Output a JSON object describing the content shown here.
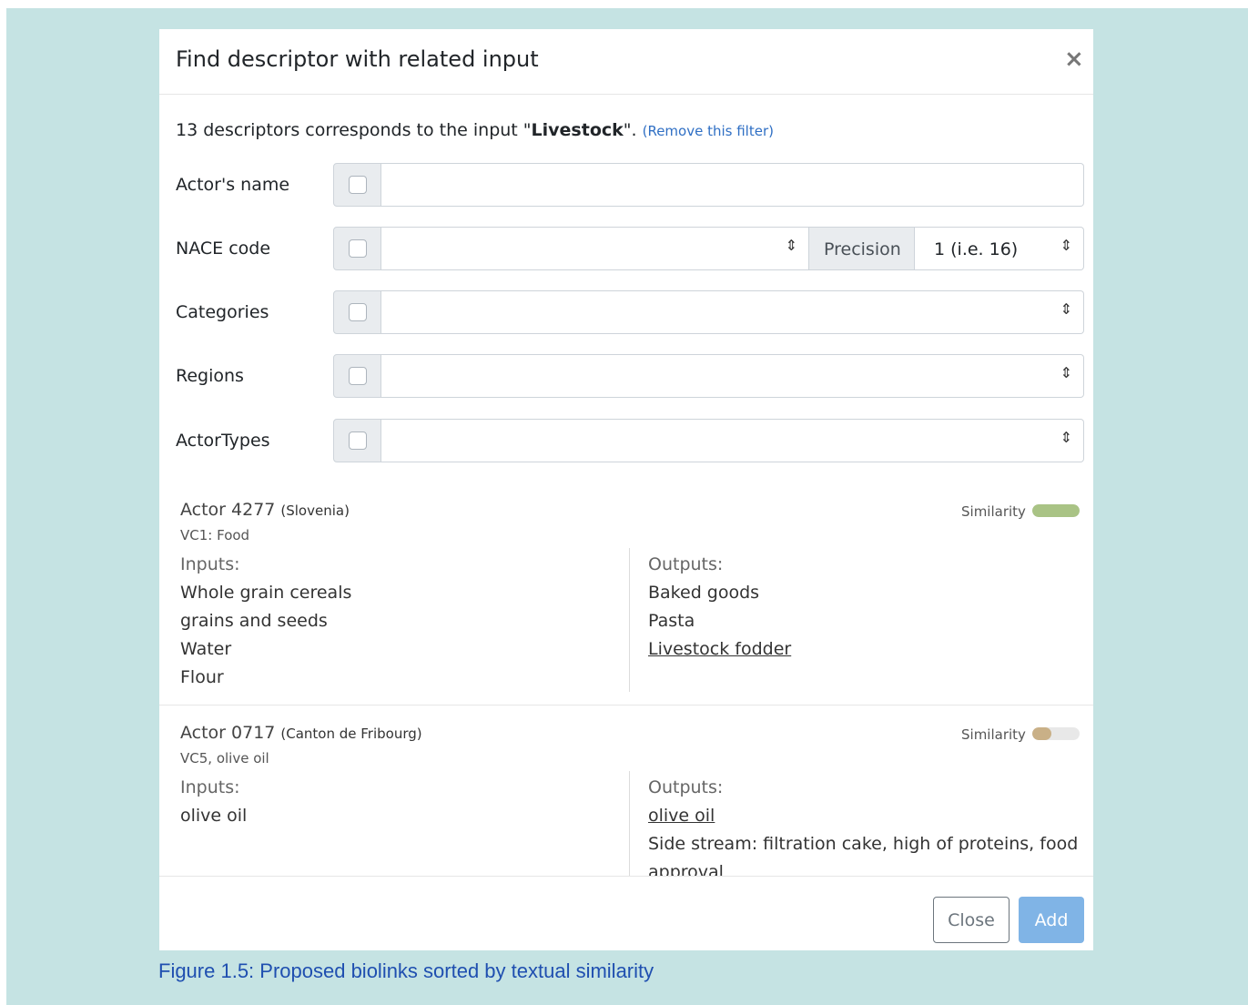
{
  "modal": {
    "title": "Find descriptor with related input",
    "close_glyph": "×"
  },
  "filter_info": {
    "count_text": "13 descriptors corresponds to the input \"",
    "term": "Livestock",
    "suffix": "\". ",
    "remove_link": "(Remove this filter)"
  },
  "form": {
    "actor_name_label": "Actor's name",
    "nace_label": "NACE code",
    "precision_label": "Precision",
    "precision_value": "1 (i.e. 16)",
    "categories_label": "Categories",
    "regions_label": "Regions",
    "actor_types_label": "ActorTypes",
    "caret": "⇕"
  },
  "results": [
    {
      "title": "Actor 4277",
      "region": "(Slovenia)",
      "subtitle": "VC1: Food",
      "similarity_label": "Similarity",
      "similarity": 1.0,
      "similarity_color": "#a9c385",
      "inputs_label": "Inputs:",
      "inputs": [
        "Whole grain cereals",
        "grains and seeds",
        "Water",
        "Flour"
      ],
      "outputs_label": "Outputs:",
      "outputs": [
        "Baked goods",
        "Pasta",
        "Livestock fodder"
      ]
    },
    {
      "title": "Actor 0717",
      "region": "(Canton de Fribourg)",
      "subtitle": "VC5, olive oil",
      "similarity_label": "Similarity",
      "similarity": 0.4,
      "similarity_color": "#c9b087",
      "inputs_label": "Inputs:",
      "inputs": [
        "olive oil"
      ],
      "outputs_label": "Outputs:",
      "outputs": [
        "olive oil",
        "Side stream: filtration cake, high of proteins, food",
        "approval"
      ]
    }
  ],
  "footer": {
    "close_label": "Close",
    "add_label": "Add"
  },
  "caption": "Figure 1.5: Proposed biolinks sorted by textual similarity"
}
